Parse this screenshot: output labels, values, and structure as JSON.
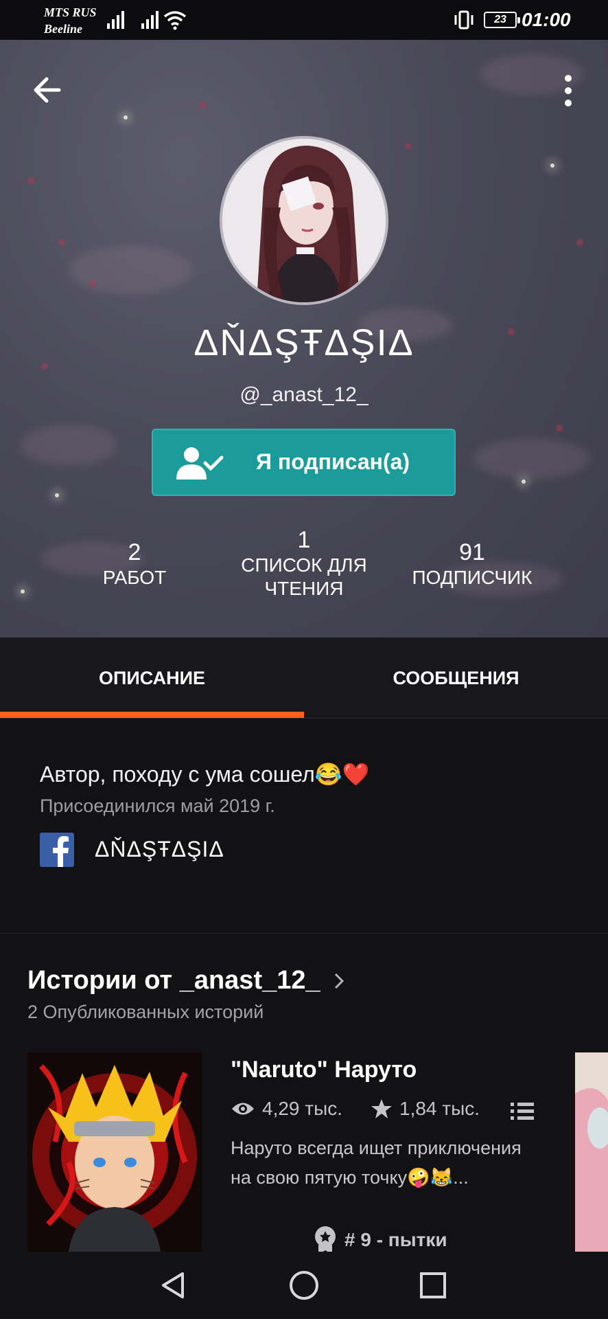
{
  "status_bar": {
    "carrier_1": "MTS RUS",
    "carrier_2": "Beeline",
    "battery": "23",
    "time": "01:00"
  },
  "profile": {
    "display_name": "ΔŇΔŞŦΔŞIΔ",
    "username": "@_anast_12_",
    "follow_button": "Я подписан(а)",
    "stats": {
      "works_count": "2",
      "works_label": "РАБОТ",
      "reading_lists_count": "1",
      "reading_lists_label_1": "СПИСОК ДЛЯ",
      "reading_lists_label_2": "ЧТЕНИЯ",
      "followers_count": "91",
      "followers_label": "ПОДПИСЧИК"
    }
  },
  "tabs": {
    "about": "ОПИСАНИЕ",
    "messages": "СООБЩЕНИЯ"
  },
  "about": {
    "description": "Автор, походу с ума сошел😂❤️",
    "joined": "Присоединился май 2019 г.",
    "facebook_name": "ΔŇΔŞŦΔŞIΔ"
  },
  "stories": {
    "title": "Истории от _anast_12_",
    "count": "2 Опубликованных историй",
    "items": [
      {
        "title": "\"Naruto\" Наруто",
        "reads": "4,29 тыс.",
        "votes": "1,84 тыс.",
        "description": "Наруто всегда ищет приключения на свою пятую точку🤪😹...",
        "rank": "# 9 - пытки"
      }
    ]
  },
  "colors": {
    "accent_orange": "#ff6122",
    "follow_teal": "#1c9b9b",
    "facebook_blue": "#3a5ea8"
  }
}
